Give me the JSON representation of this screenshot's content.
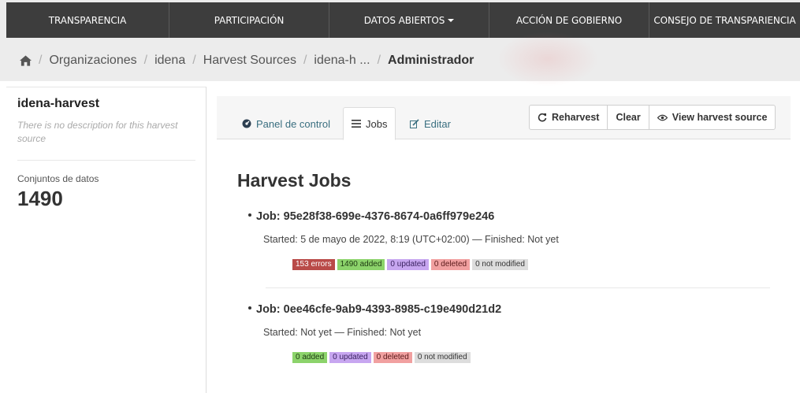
{
  "nav": {
    "items": [
      {
        "label": "TRANSPARENCIA"
      },
      {
        "label": "PARTICIPACIÓN"
      },
      {
        "label": "DATOS ABIERTOS"
      },
      {
        "label": "ACCIÓN DE GOBIERNO"
      },
      {
        "label": "CONSEJO DE TRANSPARIENCIA"
      }
    ],
    "dropdown_index": 2
  },
  "breadcrumb": {
    "items": [
      "Organizaciones",
      "idena",
      "Harvest Sources",
      "idena-h ..."
    ],
    "active": "Administrador",
    "separator": "/"
  },
  "sidebar": {
    "title": "idena-harvest",
    "description": "There is no description for this harvest source",
    "datasets_label": "Conjuntos de datos",
    "datasets_count": "1490"
  },
  "tabs": {
    "panel": "Panel de control",
    "jobs": "Jobs",
    "edit": "Editar"
  },
  "actions": {
    "reharvest": "Reharvest",
    "clear": "Clear",
    "view": "View harvest source"
  },
  "main": {
    "title": "Harvest Jobs"
  },
  "jobs": [
    {
      "id": "Job: 95e28f38-699e-4376-8674-0a6ff979e246",
      "times": "Started: 5 de mayo de 2022, 8:19 (UTC+02:00) — Finished: Not yet",
      "badges": [
        {
          "text": "153 errors",
          "bg": "#b94a48",
          "fg": "#ffffff"
        },
        {
          "text": "1490 added",
          "bg": "#8cd36b",
          "fg": "#1e3b12"
        },
        {
          "text": "0 updated",
          "bg": "#c7a6f0",
          "fg": "#3a2260"
        },
        {
          "text": "0 deleted",
          "bg": "#f1a0a0",
          "fg": "#5a1a1a"
        },
        {
          "text": "0 not modified",
          "bg": "#dddddd",
          "fg": "#333333"
        }
      ]
    },
    {
      "id": "Job: 0ee46cfe-9ab9-4393-8985-c19e490d21d2",
      "times": "Started: Not yet — Finished: Not yet",
      "badges": [
        {
          "text": "0 added",
          "bg": "#8cd36b",
          "fg": "#1e3b12"
        },
        {
          "text": "0 updated",
          "bg": "#c7a6f0",
          "fg": "#3a2260"
        },
        {
          "text": "0 deleted",
          "bg": "#f1a0a0",
          "fg": "#5a1a1a"
        },
        {
          "text": "0 not modified",
          "bg": "#dddddd",
          "fg": "#333333"
        }
      ]
    }
  ]
}
